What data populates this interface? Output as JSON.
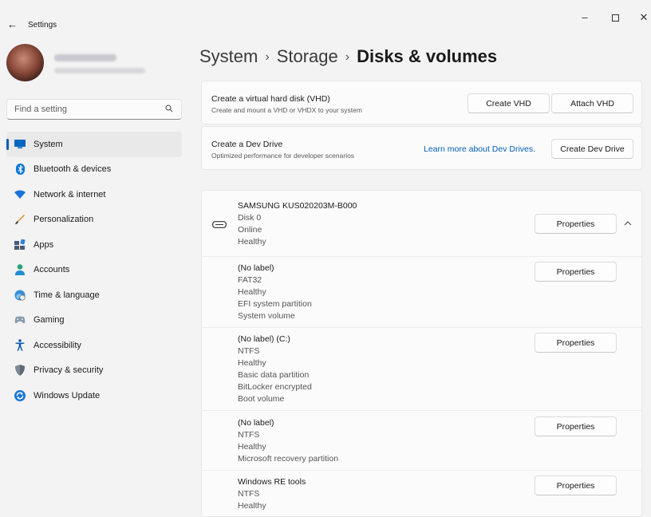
{
  "window": {
    "title": "Settings",
    "back_icon": "back-arrow-icon",
    "minimize_glyph": "–",
    "close_glyph": "✕"
  },
  "profile": {
    "name": "",
    "email": ""
  },
  "search": {
    "placeholder": "Find a setting",
    "value": ""
  },
  "sidebar": {
    "items": [
      {
        "label": "System",
        "icon": "system-icon",
        "active": true
      },
      {
        "label": "Bluetooth & devices",
        "icon": "bluetooth-icon"
      },
      {
        "label": "Network & internet",
        "icon": "wifi-icon"
      },
      {
        "label": "Personalization",
        "icon": "brush-icon"
      },
      {
        "label": "Apps",
        "icon": "apps-icon"
      },
      {
        "label": "Accounts",
        "icon": "person-icon"
      },
      {
        "label": "Time & language",
        "icon": "globe-clock-icon"
      },
      {
        "label": "Gaming",
        "icon": "controller-icon"
      },
      {
        "label": "Accessibility",
        "icon": "accessibility-icon"
      },
      {
        "label": "Privacy & security",
        "icon": "shield-icon"
      },
      {
        "label": "Windows Update",
        "icon": "update-icon"
      }
    ]
  },
  "breadcrumb": {
    "items": [
      "System",
      "Storage",
      "Disks & volumes"
    ],
    "separator": "›"
  },
  "vhd_card": {
    "title": "Create a virtual hard disk (VHD)",
    "subtitle": "Create and mount a VHD or VHDX to your system",
    "create_button": "Create VHD",
    "attach_button": "Attach VHD"
  },
  "devdrive_card": {
    "title": "Create a Dev Drive",
    "subtitle": "Optimized performance for developer scenarios",
    "learn_more": "Learn more about Dev Drives.",
    "create_button": "Create Dev Drive"
  },
  "disk": {
    "name": "SAMSUNG KUS020203M-B000",
    "number": "Disk 0",
    "status": "Online",
    "health": "Healthy",
    "properties_button": "Properties"
  },
  "volumes": [
    {
      "lines": [
        "(No label)",
        "FAT32",
        "Healthy",
        "EFI system partition",
        "System volume"
      ],
      "properties_button": "Properties"
    },
    {
      "lines": [
        "(No label) (C:)",
        "NTFS",
        "Healthy",
        "Basic data partition",
        "BitLocker encrypted",
        "Boot volume"
      ],
      "properties_button": "Properties"
    },
    {
      "lines": [
        "(No label)",
        "NTFS",
        "Healthy",
        "Microsoft recovery partition"
      ],
      "properties_button": "Properties"
    },
    {
      "lines": [
        "Windows RE tools",
        "NTFS",
        "Healthy"
      ],
      "properties_button": "Properties"
    }
  ],
  "colors": {
    "accent": "#005fb8",
    "background": "#f3f3f3",
    "card": "#fbfbfb"
  }
}
